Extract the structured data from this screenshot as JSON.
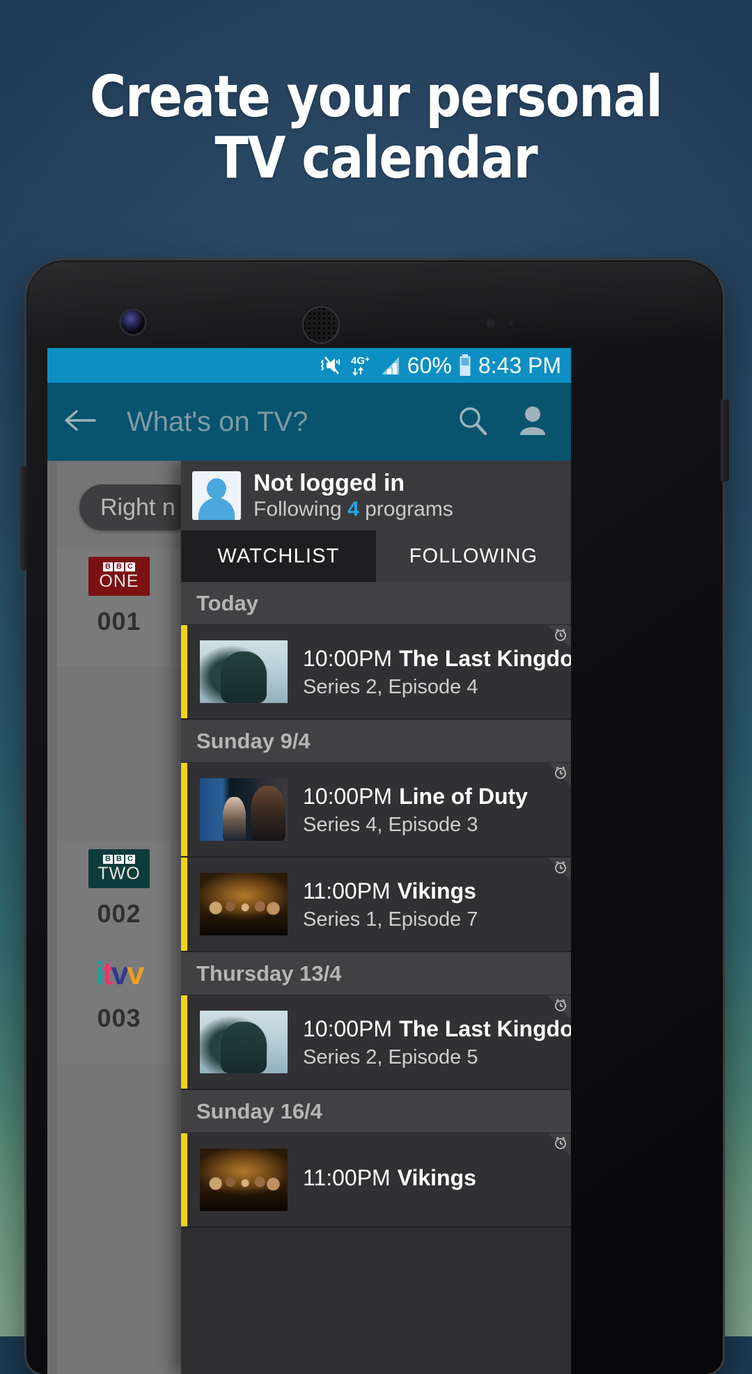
{
  "promo": {
    "headline_line1": "Create your personal",
    "headline_line2": "TV calendar"
  },
  "statusbar": {
    "icons": [
      "vibrate-mute-icon",
      "4g-plus-icon",
      "signal-bars-icon",
      "battery-icon"
    ],
    "network_label": "4G+",
    "battery_percent": "60%",
    "clock": "8:43 PM"
  },
  "toolbar": {
    "back_label": "back-arrow",
    "title": "What's on TV?",
    "search_label": "search-icon",
    "account_label": "account-icon"
  },
  "rail": {
    "right_now_pill": "Right n",
    "channels": [
      {
        "bbc": [
          "B",
          "B",
          "C"
        ],
        "word": "ONE",
        "number": "001",
        "color": "#7b1113"
      },
      {
        "bbc": [
          "B",
          "B",
          "C"
        ],
        "word": "TWO",
        "number": "002",
        "color": "#0e3c3c"
      },
      {
        "word": "itv",
        "number": "003",
        "color": "transparent"
      }
    ]
  },
  "drawer": {
    "account": {
      "name": "Not logged in",
      "following_prefix": "Following ",
      "following_count": "4",
      "following_suffix": " programs"
    },
    "tabs": [
      {
        "label": "WATCHLIST",
        "selected": true
      },
      {
        "label": "FOLLOWING",
        "selected": false
      }
    ],
    "groups": [
      {
        "day": "Today",
        "items": [
          {
            "time": "10:00PM",
            "name": "The Last Kingdom",
            "detail": "Series 2, Episode 4",
            "art": "art-kingdom",
            "reminder": "alarm-clock-icon"
          }
        ]
      },
      {
        "day": "Sunday 9/4",
        "items": [
          {
            "time": "10:00PM",
            "name": "Line of Duty",
            "detail": "Series 4, Episode 3",
            "art": "art-duty",
            "reminder": "alarm-clock-icon"
          },
          {
            "time": "11:00PM",
            "name": "Vikings",
            "detail": "Series 1, Episode 7",
            "art": "art-vikings",
            "reminder": "alarm-clock-icon"
          }
        ]
      },
      {
        "day": "Thursday 13/4",
        "items": [
          {
            "time": "10:00PM",
            "name": "The Last Kingdom",
            "detail": "Series 2, Episode 5",
            "art": "art-kingdom",
            "reminder": "alarm-clock-icon"
          }
        ]
      },
      {
        "day": "Sunday 16/4",
        "items": [
          {
            "time": "11:00PM",
            "name": "Vikings",
            "detail": "",
            "art": "art-vikings",
            "reminder": "alarm-clock-icon"
          }
        ]
      }
    ]
  },
  "colors": {
    "statusbar": "#0d8fc4",
    "toolbar": "#08536e",
    "accent_yellow": "#f2d21a",
    "link_blue": "#27a3e0",
    "drawer_bg": "#2e2e31",
    "promo_bg": "#244564"
  }
}
